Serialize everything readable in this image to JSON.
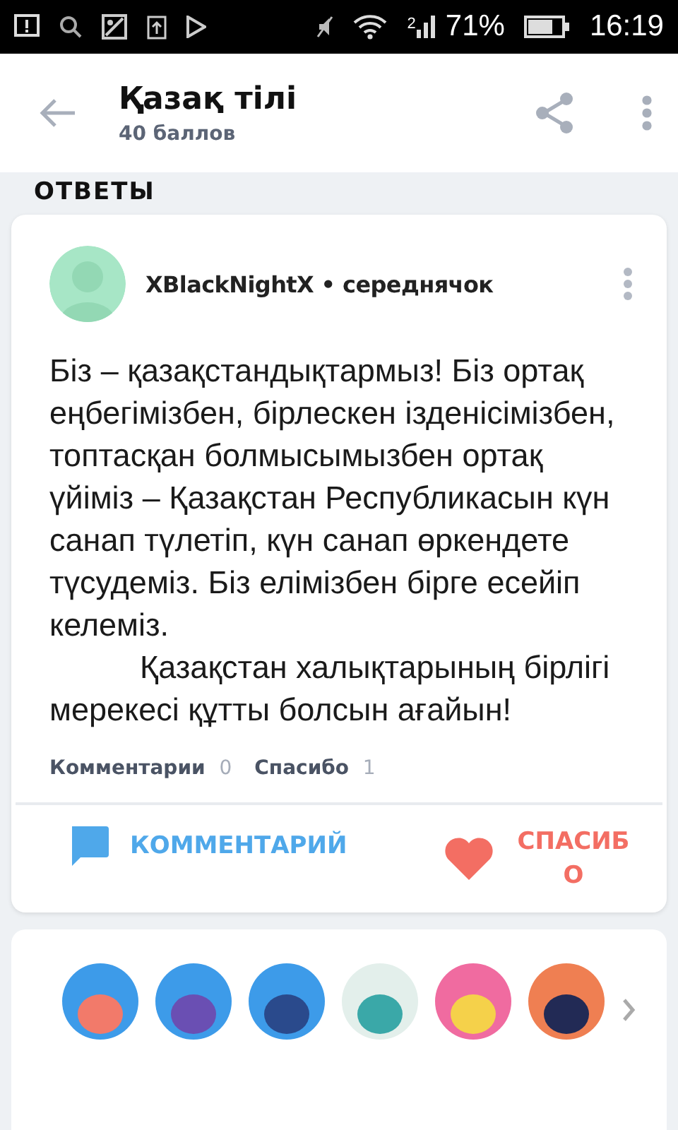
{
  "status_bar": {
    "sim": "2",
    "battery": "71%",
    "time": "16:19"
  },
  "header": {
    "title": "Қазақ тілі",
    "subtitle": "40 баллов"
  },
  "section_title": "ОТВЕТЫ",
  "answer": {
    "author": "XBlackNightX",
    "rank": "• середнячок",
    "paragraphs": [
      {
        "kind": "plain",
        "text": "Біз – қазақстандықтармыз! Біз ортақ еңбегімізбен, бірлескен ізденісімізбен, топтасқан болмысымызбен ортақ үйіміз – Қазақстан Республикасын күн санап түлетіп, күн санап өркендете түсудеміз. Біз елімізбен бірге есейіп келеміз."
      },
      {
        "kind": "indented",
        "text": "Қазақстан халықтарының бірлігі мерекесі құтты болсын ағайын!"
      }
    ],
    "stats": [
      {
        "label": "Комментарии",
        "count": "0"
      },
      {
        "label": "Спасибо",
        "count": "1"
      }
    ],
    "actions": [
      {
        "kind": "comment",
        "label": "КОММЕНТАРИЙ"
      },
      {
        "kind": "thanks",
        "label": "СПАСИБО"
      }
    ]
  },
  "subjects": [
    {
      "color": "#3d9be9"
    },
    {
      "color": "#3d9be9"
    },
    {
      "color": "#3d9be9"
    },
    {
      "color": "#e3efeb"
    },
    {
      "color": "#f06ba0"
    },
    {
      "color": "#ef7f52"
    }
  ]
}
